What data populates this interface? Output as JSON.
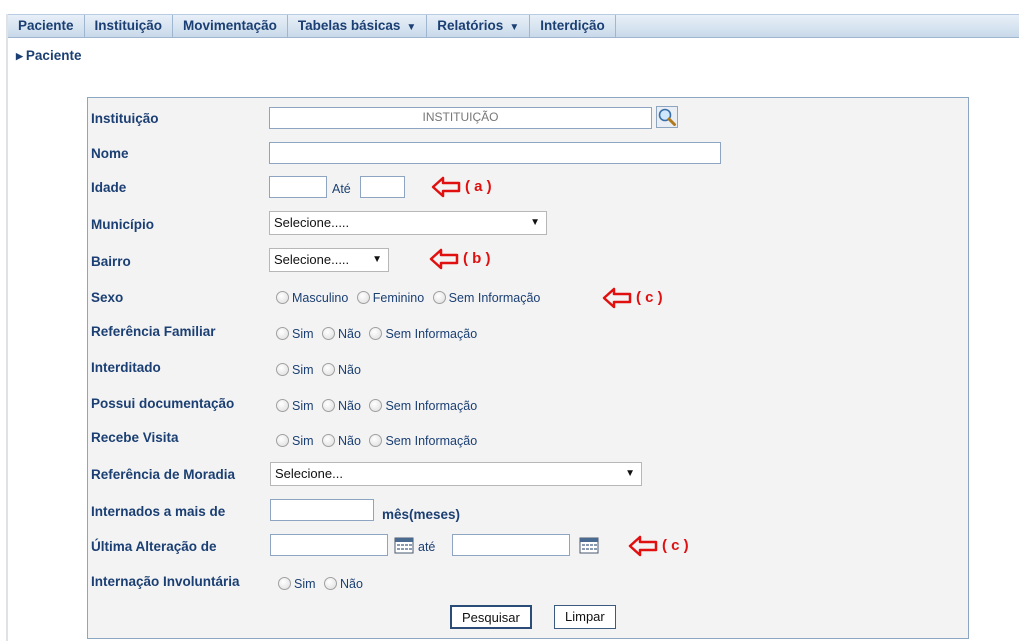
{
  "menu": [
    {
      "label": "Paciente",
      "caret": false
    },
    {
      "label": "Instituição",
      "caret": false
    },
    {
      "label": "Movimentação",
      "caret": false
    },
    {
      "label": "Tabelas básicas",
      "caret": true
    },
    {
      "label": "Relatórios",
      "caret": true
    },
    {
      "label": "Interdição",
      "caret": false
    }
  ],
  "breadcrumb": "Paciente",
  "form": {
    "instituicao_label": "Instituição",
    "instituicao_placeholder": "INSTITUIÇÃO",
    "nome_label": "Nome",
    "idade_label": "Idade",
    "idade_ate": "Até",
    "municipio_label": "Município",
    "municipio_value": "Selecione.....",
    "bairro_label": "Bairro",
    "bairro_value": "Selecione.....",
    "sexo_label": "Sexo",
    "sexo_options": [
      "Masculino",
      "Feminino",
      "Sem Informação"
    ],
    "ref_familiar_label": "Referência Familiar",
    "ref_familiar_options": [
      "Sim",
      "Não",
      "Sem Informação"
    ],
    "interditado_label": "Interditado",
    "interditado_options": [
      "Sim",
      "Não"
    ],
    "documentacao_label": "Possui documentação",
    "documentacao_options": [
      "Sim",
      "Não",
      "Sem Informação"
    ],
    "visita_label": "Recebe Visita",
    "visita_options": [
      "Sim",
      "Não",
      "Sem Informação"
    ],
    "moradia_label": "Referência de Moradia",
    "moradia_value": "Selecione...",
    "internados_label": "Internados a mais de",
    "internados_unit": "mês(meses)",
    "ultima_label": "Última Alteração de",
    "ultima_ate": "até",
    "involuntaria_label": "Internação Involuntária",
    "involuntaria_options": [
      "Sim",
      "Não"
    ],
    "pesquisar": "Pesquisar",
    "limpar": "Limpar"
  },
  "annotations": {
    "a": "( a )",
    "b": "( b )",
    "c1": "( c )",
    "c2": "( c )",
    "color": "#e01010"
  },
  "icons": {
    "search": "magnifier-icon",
    "calendar": "calendar-icon"
  }
}
